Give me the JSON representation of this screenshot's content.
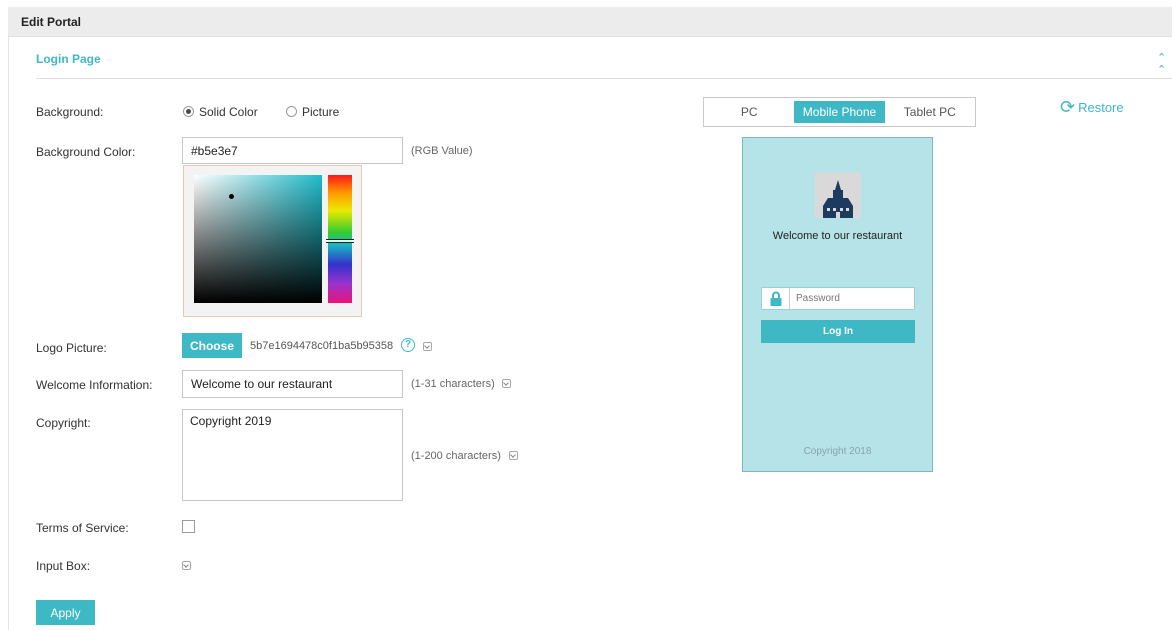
{
  "header": {
    "title": "Edit Portal"
  },
  "section": {
    "title": "Login Page"
  },
  "form": {
    "background_label": "Background:",
    "background_options": [
      "Solid Color",
      "Picture"
    ],
    "background_color_label": "Background Color:",
    "background_color_value": "#b5e3e7",
    "background_color_hint": "(RGB Value)",
    "logo_label": "Logo Picture:",
    "choose_label": "Choose",
    "logo_filename": "5b7e1694478c0f1ba5b95358",
    "help_glyph": "?",
    "welcome_label": "Welcome Information:",
    "welcome_value": "Welcome to our restaurant",
    "welcome_hint": "(1-31 characters)",
    "copyright_label": "Copyright:",
    "copyright_value": "Copyright 2019",
    "copyright_hint": "(1-200 characters)",
    "terms_label": "Terms of Service:",
    "input_box_label": "Input Box:",
    "apply_label": "Apply"
  },
  "preview": {
    "tabs": [
      "PC",
      "Mobile Phone",
      "Tablet PC"
    ],
    "active_tab": "Mobile Phone",
    "restore_label": "Restore",
    "welcome": "Welcome to our restaurant",
    "password_placeholder": "Password",
    "login_label": "Log In",
    "copyright": "Copyright 2018"
  },
  "colors": {
    "accent": "#3fb8c6",
    "preview_background": "#b5e3e7"
  }
}
